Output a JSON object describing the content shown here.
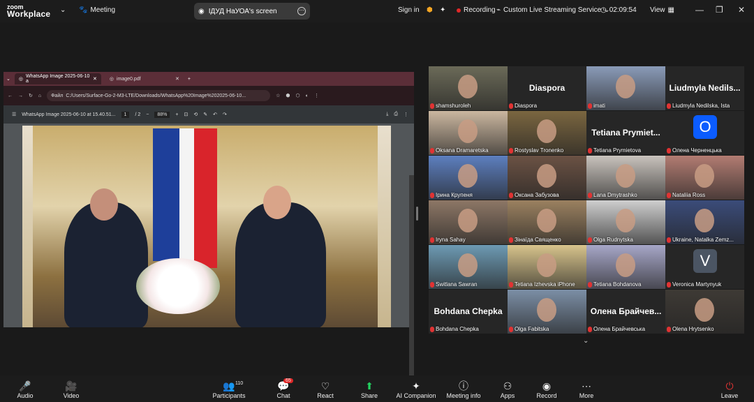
{
  "app": {
    "logo_top": "zoom",
    "logo_bottom": "Workplace",
    "meeting_label": "Meeting"
  },
  "share_pill": {
    "text": "ІДУД НаУОА's screen"
  },
  "topbar": {
    "sign_in": "Sign in",
    "recording": "Recording",
    "streaming": "Custom Live Streaming Service",
    "time": "02:09:54",
    "view": "View"
  },
  "browser": {
    "tab1": "WhatsApp Image 2025-06-10 a",
    "tab2": "image0.pdf",
    "url_prefix": "Файл",
    "url": "C:/Users/Surface-Go-2-M3-LTE/Downloads/WhatsApp%20Image%202025-06-10...",
    "pdf_title": "WhatsApp Image 2025-06-10 at 15.40.51...",
    "page_current": "1",
    "page_total": "/ 2",
    "zoom": "88%"
  },
  "gallery": [
    {
      "name": "shamshuroleh",
      "big": "",
      "avatar": "",
      "cam": "#6b6a58"
    },
    {
      "name": "Diaspora",
      "big": "Diaspora",
      "avatar": "",
      "cam": ""
    },
    {
      "name": "imati",
      "big": "",
      "avatar": "",
      "cam": "#8a9bb8"
    },
    {
      "name": "Liudmyla Nedilska, Ista",
      "big": "Liudmyla Nedils...",
      "avatar": "",
      "cam": ""
    },
    {
      "name": "Oksana Dramaretska",
      "big": "",
      "avatar": "",
      "cam": "#cbb7a0"
    },
    {
      "name": "Rostyslav Tronenko",
      "big": "",
      "avatar": "",
      "cam": "#7b6640"
    },
    {
      "name": "Tetiana Prymietova",
      "big": "Tetiana Prymiet...",
      "avatar": "",
      "cam": ""
    },
    {
      "name": "Олена Черненцька",
      "big": "",
      "avatar": "O",
      "cam": ""
    },
    {
      "name": "Ірина Крупеня",
      "big": "",
      "avatar": "",
      "cam": "#5d7fbf"
    },
    {
      "name": "Оксана Забузова",
      "big": "",
      "avatar": "",
      "cam": "#6b5244"
    },
    {
      "name": "Lana Dmytrashko",
      "big": "",
      "avatar": "",
      "cam": "#c9c3bd"
    },
    {
      "name": "Nataliia Ross",
      "big": "",
      "avatar": "",
      "cam": "#b27c72"
    },
    {
      "name": "Iryna Sahay",
      "big": "",
      "avatar": "",
      "cam": "#8d7766"
    },
    {
      "name": "Зінаїда Священко",
      "big": "",
      "avatar": "",
      "cam": "#9b8160"
    },
    {
      "name": "Olga Rudnytska",
      "big": "",
      "avatar": "",
      "cam": "#cfcfcf"
    },
    {
      "name": "Ukraine, Natalka Zemz...",
      "big": "",
      "avatar": "",
      "cam": "#3b4c7a"
    },
    {
      "name": "Switlana Sawran",
      "big": "",
      "avatar": "",
      "cam": "#6d9ab3"
    },
    {
      "name": "Tetiana Izhevska iPhone",
      "big": "",
      "avatar": "",
      "cam": "#d8c48c"
    },
    {
      "name": "Tetiana Bohdanova",
      "big": "",
      "avatar": "",
      "cam": "#a7a7c8"
    },
    {
      "name": "Veronica Martynyuk",
      "big": "",
      "avatar": "V",
      "cam": ""
    },
    {
      "name": "Bohdana Chepka",
      "big": "Bohdana Chepka",
      "avatar": "",
      "cam": ""
    },
    {
      "name": "Olga Fabitska",
      "big": "",
      "avatar": "",
      "cam": "#7c8fa6"
    },
    {
      "name": "Олена Брайчевська",
      "big": "Олена Брайчев...",
      "avatar": "",
      "cam": ""
    },
    {
      "name": "Olena Hrytsenko",
      "big": "",
      "avatar": "",
      "cam": "#3e3a35"
    }
  ],
  "bottombar": [
    {
      "label": "Audio",
      "icon": "🎤",
      "badge": ""
    },
    {
      "label": "Video",
      "icon": "🎥",
      "badge": ""
    },
    {
      "label": "Participants",
      "icon": "👥",
      "badge": "110"
    },
    {
      "label": "Chat",
      "icon": "💬",
      "badge": "65"
    },
    {
      "label": "React",
      "icon": "♡",
      "badge": ""
    },
    {
      "label": "Share",
      "icon": "⬆",
      "badge": ""
    },
    {
      "label": "AI Companion",
      "icon": "✦",
      "badge": ""
    },
    {
      "label": "Meeting info",
      "icon": "ⓘ",
      "badge": ""
    },
    {
      "label": "Apps",
      "icon": "⚇",
      "badge": ""
    },
    {
      "label": "Record",
      "icon": "◉",
      "badge": ""
    },
    {
      "label": "More",
      "icon": "⋯",
      "badge": ""
    },
    {
      "label": "Leave",
      "icon": "⏻",
      "badge": ""
    }
  ],
  "colors": {
    "accent": "#0b5cff",
    "record": "#e02828",
    "speaker": "#23d160",
    "avatar_blue": "#0b5cff",
    "avatar_gray": "#4b5563"
  }
}
